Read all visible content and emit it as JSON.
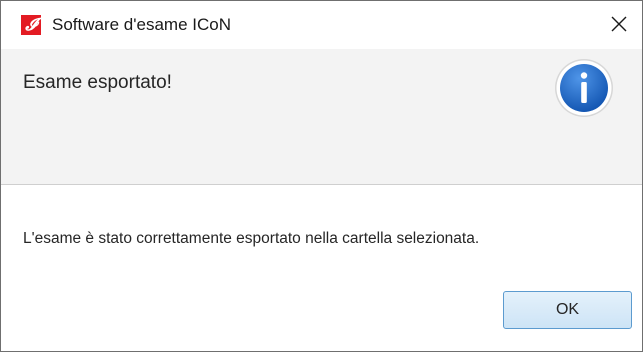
{
  "window": {
    "title": "Software d'esame ICoN",
    "app_icon_glyph": "𝓘",
    "app_icon_color": "#e31b23",
    "close_icon": "close-icon"
  },
  "header": {
    "text": "Esame esportato!",
    "icon": "info-icon",
    "icon_color": "#1f6fd0"
  },
  "content": {
    "message": "L'esame è stato correttamente esportato nella cartella selezionata."
  },
  "buttons": {
    "ok_label": "OK"
  }
}
